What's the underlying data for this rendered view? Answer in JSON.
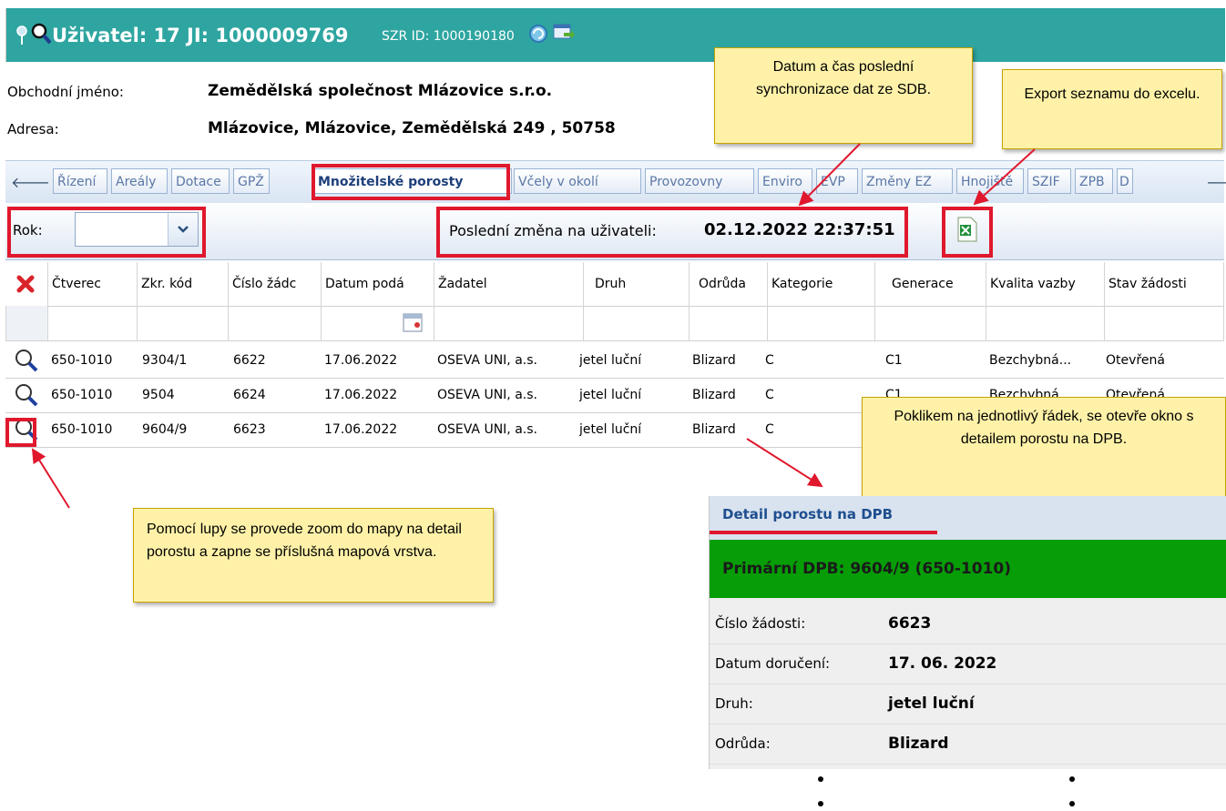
{
  "header": {
    "title": "Uživatel: 17 JI: 1000009769",
    "szr": "SZR ID: 1000190180"
  },
  "info": {
    "business_name_label": "Obchodní jméno:",
    "business_name": "Zemědělská společnost Mlázovice s.r.o.",
    "address_label": "Adresa:",
    "address": "Mlázovice, Mlázovice, Zemědělská 249 , 50758"
  },
  "tabs": [
    "Řízení",
    "Areály",
    "Dotace",
    "GPŽ",
    "Množitelské porosty",
    "Včely v okolí",
    "Provozovny",
    "Enviro",
    "EVP",
    "Změny EZ",
    "Hnojiště",
    "SZIF",
    "ZPB",
    "D"
  ],
  "active_tab": "Množitelské porosty",
  "toolbar": {
    "year_label": "Rok:",
    "year_value": "",
    "last_change_label": "Poslední změna na uživateli:",
    "last_change_value": "02.12.2022 22:37:51"
  },
  "grid": {
    "columns": [
      "Čtverec",
      "Zkr. kód",
      "Číslo žádc",
      "Datum podá",
      "Žadatel",
      "Druh",
      "Odrůda",
      "Kategorie",
      "Generace",
      "Kvalita vazby",
      "Stav žádosti"
    ],
    "rows": [
      [
        "650-1010",
        "9304/1",
        "6622",
        "17.06.2022",
        "OSEVA UNI, a.s.",
        "jetel luční",
        "Blizard",
        "C",
        "C1",
        "Bezchybná...",
        "Otevřená"
      ],
      [
        "650-1010",
        "9504",
        "6624",
        "17.06.2022",
        "OSEVA UNI, a.s.",
        "jetel luční",
        "Blizard",
        "C",
        "C1",
        "Bezchybná...",
        "Otevřená"
      ],
      [
        "650-1010",
        "9604/9",
        "6623",
        "17.06.2022",
        "OSEVA UNI, a.s.",
        "jetel luční",
        "Blizard",
        "C",
        "",
        "",
        ""
      ]
    ]
  },
  "callouts": {
    "sync": "Datum a čas poslední synchronizace dat ze SDB.",
    "export": "Export seznamu do excelu.",
    "row_click": "Poklikem na jednotlivý řádek, se otevře okno s detailem porostu na DPB.",
    "zoom": "Pomocí lupy se provede zoom do mapy na detail porostu a zapne se příslušná mapová vrstva."
  },
  "detail": {
    "title": "Detail porostu na DPB",
    "primary": "Primární DPB: 9604/9 (650-1010)",
    "fields": [
      {
        "label": "Číslo žádosti:",
        "value": "6623"
      },
      {
        "label": "Datum doručení:",
        "value": "17. 06. 2022"
      },
      {
        "label": "Druh:",
        "value": "jetel luční"
      },
      {
        "label": "Odrůda:",
        "value": "Blizard"
      }
    ]
  },
  "colors": {
    "header_bg": "#2ea5a0",
    "highlight_red": "#e0182d",
    "callout_bg": "#fff2a8",
    "detail_green": "#079d07"
  }
}
